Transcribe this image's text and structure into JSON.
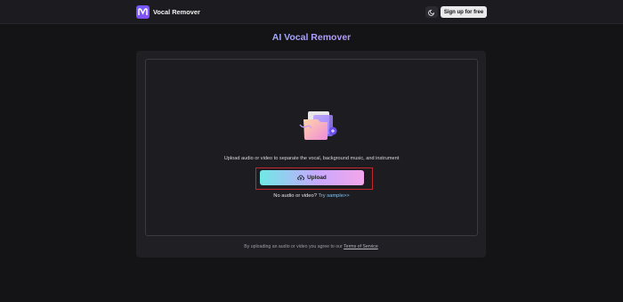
{
  "header": {
    "app_name": "Vocal Remover",
    "logo_icon": "m-logo-icon",
    "theme_icon": "theme-toggle-icon",
    "signup_label": "Sign up for free"
  },
  "main": {
    "title": "AI Vocal Remover",
    "illustration": "folder-with-audio-illustration",
    "description": "Upload audio or video to separate the vocal, background music, and instrument",
    "upload_label": "Upload",
    "upload_icon": "cloud-upload-icon",
    "no_audio_text": "No audio or video?",
    "try_sample_label": "Try sample>>",
    "terms_prefix": "By uploading an audio or video you agree to our",
    "terms_link": "Terms of Service"
  },
  "colors": {
    "background": "#141417",
    "topbar": "#1c1c20",
    "card": "#202024",
    "accent_cyan": "#6ee9e5",
    "accent_purple": "#c8a8ff",
    "accent_pink": "#f4a6ea",
    "highlight_red": "#c4262e"
  }
}
